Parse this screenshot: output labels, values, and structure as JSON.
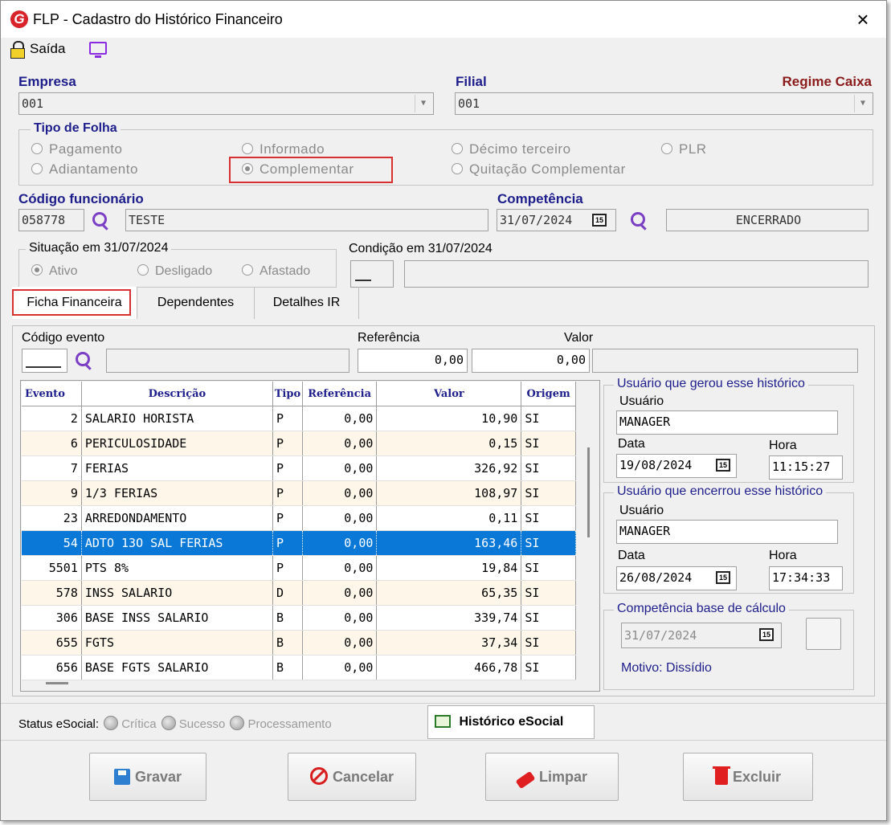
{
  "window": {
    "title": "FLP - Cadastro do Histórico Financeiro",
    "close": "×",
    "logo": "G"
  },
  "menubar": {
    "exit_label": "Saída"
  },
  "empresa": {
    "label": "Empresa",
    "value": "001"
  },
  "filial": {
    "label": "Filial",
    "value": "001",
    "regime": "Regime Caixa"
  },
  "tipo_folha": {
    "title": "Tipo de Folha",
    "options": [
      "Pagamento",
      "Informado",
      "Décimo terceiro",
      "PLR",
      "Adiantamento",
      "Complementar",
      "Quitação Complementar"
    ],
    "selected": "Complementar"
  },
  "funcionario": {
    "label": "Código funcionário",
    "code": "058778",
    "name": "TESTE"
  },
  "competencia": {
    "label": "Competência",
    "date": "31/07/2024",
    "status": "ENCERRADO"
  },
  "situacao": {
    "title": "Situação em 31/07/2024",
    "options": [
      "Ativo",
      "Desligado",
      "Afastado"
    ],
    "selected": "Ativo"
  },
  "condicao": {
    "title": "Condição em 31/07/2024",
    "code": "",
    "desc": ""
  },
  "tabs": [
    {
      "label": "Ficha Financeira"
    },
    {
      "label": "Dependentes"
    },
    {
      "label": "Detalhes IR"
    }
  ],
  "evento_form": {
    "codigo_label": "Código evento",
    "referencia_label": "Referência",
    "valor_label": "Valor",
    "referencia": "0,00",
    "valor": "0,00"
  },
  "grid": {
    "headers": [
      "Evento",
      "Descrição",
      "Tipo",
      "Referência",
      "Valor",
      "Origem"
    ],
    "rows": [
      {
        "evento": "2",
        "descricao": "SALARIO HORISTA",
        "tipo": "P",
        "referencia": "0,00",
        "valor": "10,90",
        "origem": "SI"
      },
      {
        "evento": "6",
        "descricao": "PERICULOSIDADE",
        "tipo": "P",
        "referencia": "0,00",
        "valor": "0,15",
        "origem": "SI"
      },
      {
        "evento": "7",
        "descricao": "FERIAS",
        "tipo": "P",
        "referencia": "0,00",
        "valor": "326,92",
        "origem": "SI"
      },
      {
        "evento": "9",
        "descricao": "1/3 FERIAS",
        "tipo": "P",
        "referencia": "0,00",
        "valor": "108,97",
        "origem": "SI"
      },
      {
        "evento": "23",
        "descricao": "ARREDONDAMENTO",
        "tipo": "P",
        "referencia": "0,00",
        "valor": "0,11",
        "origem": "SI"
      },
      {
        "evento": "54",
        "descricao": "ADTO 13O SAL FERIAS",
        "tipo": "P",
        "referencia": "0,00",
        "valor": "163,46",
        "origem": "SI"
      },
      {
        "evento": "5501",
        "descricao": "PTS 8%",
        "tipo": "P",
        "referencia": "0,00",
        "valor": "19,84",
        "origem": "SI"
      },
      {
        "evento": "578",
        "descricao": "INSS SALARIO",
        "tipo": "D",
        "referencia": "0,00",
        "valor": "65,35",
        "origem": "SI"
      },
      {
        "evento": "306",
        "descricao": "BASE INSS SALARIO",
        "tipo": "B",
        "referencia": "0,00",
        "valor": "339,74",
        "origem": "SI"
      },
      {
        "evento": "655",
        "descricao": "FGTS",
        "tipo": "B",
        "referencia": "0,00",
        "valor": "37,34",
        "origem": "SI"
      },
      {
        "evento": "656",
        "descricao": "BASE FGTS SALARIO",
        "tipo": "B",
        "referencia": "0,00",
        "valor": "466,78",
        "origem": "SI"
      }
    ],
    "selected_index": 5
  },
  "gerou": {
    "title": "Usuário que gerou esse histórico",
    "usuario_label": "Usuário",
    "usuario": "MANAGER",
    "data_label": "Data",
    "data": "19/08/2024",
    "hora_label": "Hora",
    "hora": "11:15:27"
  },
  "encerrou": {
    "title": "Usuário que encerrou esse histórico",
    "usuario_label": "Usuário",
    "usuario": "MANAGER",
    "data_label": "Data",
    "data": "26/08/2024",
    "hora_label": "Hora",
    "hora": "17:34:33"
  },
  "base_calculo": {
    "title": "Competência base de cálculo",
    "data": "31/07/2024",
    "motivo": "Motivo: Dissídio"
  },
  "esocial": {
    "status_label": "Status eSocial:",
    "critica": "Crítica",
    "sucesso": "Sucesso",
    "processamento": "Processamento",
    "historico_button": "Histórico eSocial"
  },
  "buttons": {
    "gravar": "Gravar",
    "cancelar": "Cancelar",
    "limpar": "Limpar",
    "excluir": "Excluir"
  },
  "calendar_icon_text": "15"
}
